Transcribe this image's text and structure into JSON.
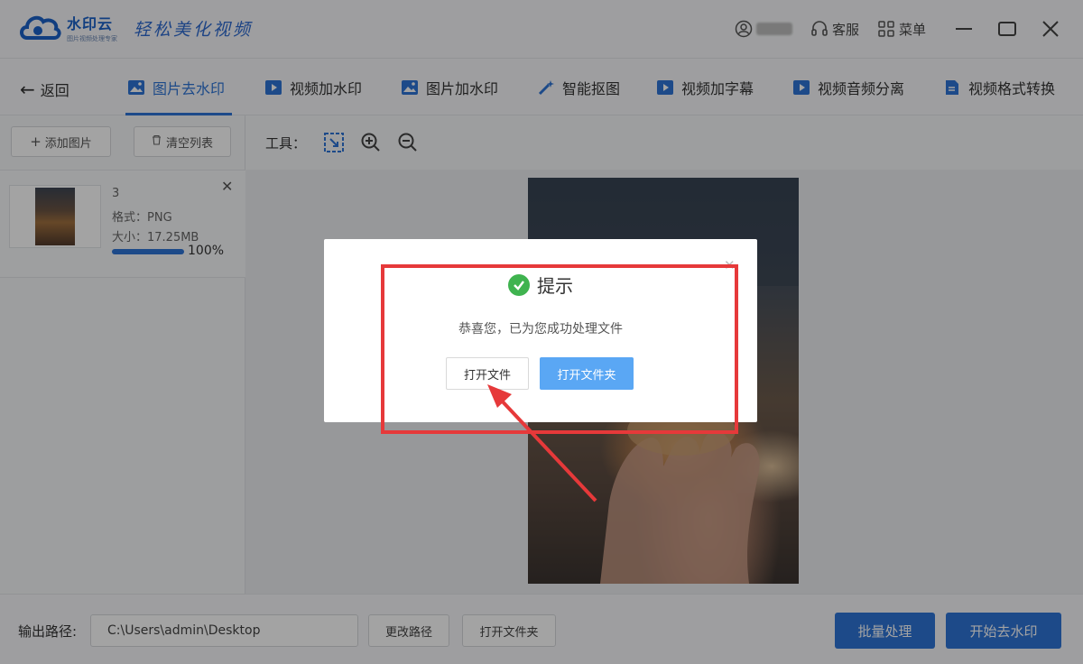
{
  "app": {
    "name": "水印云",
    "subtitle": "图片视频处理专家",
    "slogan": "轻松美化视频",
    "accent": "#2e74d6"
  },
  "titlebar": {
    "service_label": "客服",
    "menu_label": "菜单",
    "icons": [
      "user-icon",
      "headset-icon",
      "grid-menu-icon",
      "minimize-icon",
      "maximize-icon",
      "close-icon"
    ]
  },
  "nav": {
    "back_label": "返回",
    "tabs": [
      {
        "label": "图片去水印",
        "icon": "image-icon",
        "active": true
      },
      {
        "label": "视频加水印",
        "icon": "video-icon",
        "active": false
      },
      {
        "label": "图片加水印",
        "icon": "image-icon",
        "active": false
      },
      {
        "label": "智能抠图",
        "icon": "magic-wand-icon",
        "active": false
      },
      {
        "label": "视频加字幕",
        "icon": "video-icon",
        "active": false
      },
      {
        "label": "视频音频分离",
        "icon": "video-icon",
        "active": false
      },
      {
        "label": "视频格式转换",
        "icon": "file-convert-icon",
        "active": false
      }
    ]
  },
  "left_panel": {
    "add_label": "添加图片",
    "clear_label": "清空列表",
    "files": [
      {
        "name": "3",
        "format": "格式：PNG",
        "size": "大小：17.25MB",
        "progress": 100,
        "progress_text": "100%"
      }
    ]
  },
  "toolbar": {
    "label": "工具："
  },
  "bottom": {
    "output_label": "输出路径:",
    "output_path": "C:\\Users\\admin\\Desktop",
    "change_path_label": "更改路径",
    "open_folder_label": "打开文件夹",
    "batch_label": "批量处理",
    "start_label": "开始去水印"
  },
  "dialog": {
    "title": "提示",
    "message": "恭喜您，已为您成功处理文件",
    "open_file_label": "打开文件",
    "open_folder_label": "打开文件夹"
  }
}
